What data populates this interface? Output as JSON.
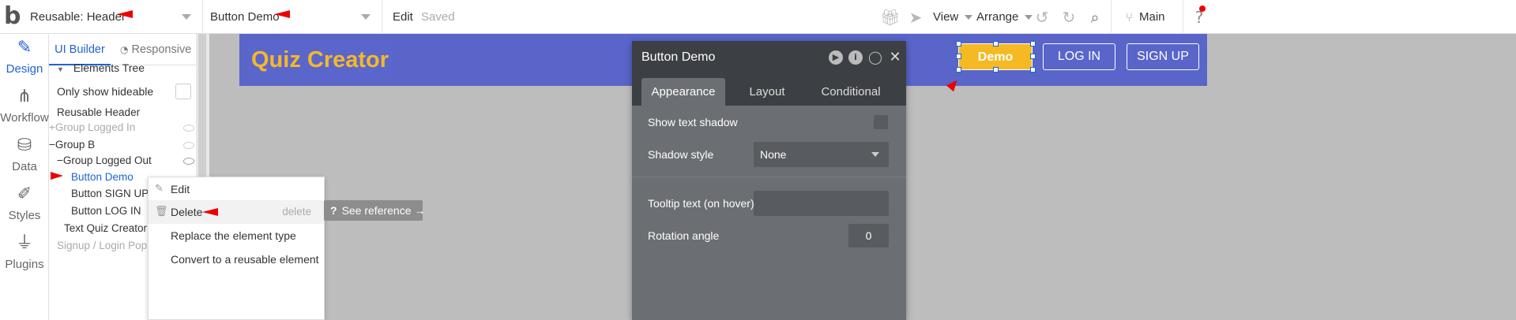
{
  "topbar": {
    "logo_text": "b",
    "page_dropdown": "Reusable: Header",
    "element_dropdown": "Button Demo",
    "edit_label": "Edit",
    "save_status": "Saved",
    "view_label": "View",
    "arrange_label": "Arrange",
    "branch_label": "Main"
  },
  "rail": [
    {
      "label": "Design",
      "icon": "pencil-ruler-icon",
      "glyph": "✎"
    },
    {
      "label": "Workflow",
      "icon": "workflow-icon",
      "glyph": "⋔"
    },
    {
      "label": "Data",
      "icon": "database-icon",
      "glyph": "⛁"
    },
    {
      "label": "Styles",
      "icon": "brush-icon",
      "glyph": "✐"
    },
    {
      "label": "Plugins",
      "icon": "plug-icon",
      "glyph": "⏚"
    }
  ],
  "panel": {
    "tab_ui_builder": "UI Builder",
    "tab_responsive": "Responsive",
    "elements_tree_label": "Elements Tree",
    "only_show_hideable": "Only show hideable",
    "tree": [
      {
        "label": "Reusable Header",
        "prefix": ""
      },
      {
        "label": "Group Logged In",
        "prefix": "+"
      },
      {
        "label": "Group B",
        "prefix": "−"
      },
      {
        "label": "Group Logged Out",
        "prefix": "−"
      },
      {
        "label": "Button Demo",
        "prefix": ""
      },
      {
        "label": "Button SIGN UP",
        "prefix": ""
      },
      {
        "label": "Button LOG IN",
        "prefix": ""
      },
      {
        "label": "Text Quiz Creator",
        "prefix": ""
      },
      {
        "label": "Signup / Login Popup",
        "prefix": ""
      }
    ]
  },
  "context_menu": {
    "edit": "Edit",
    "delete": "Delete",
    "delete_shortcut": "delete",
    "replace": "Replace the element type",
    "convert": "Convert to a reusable element",
    "see_reference": "See reference →"
  },
  "canvas": {
    "title": "Quiz Creator",
    "btn_demo": "Demo",
    "btn_login": "LOG IN",
    "btn_signup": "SIGN UP",
    "colors": {
      "header_bg": "#5965c9",
      "title": "#f5b82a",
      "demo_bg": "#f5b923"
    }
  },
  "property_editor": {
    "title": "Button Demo",
    "tabs": [
      "Appearance",
      "Layout",
      "Conditional"
    ],
    "show_text_shadow_label": "Show text shadow",
    "shadow_style_label": "Shadow style",
    "shadow_style_value": "None",
    "tooltip_label": "Tooltip text (on hover)",
    "tooltip_value": "",
    "rotation_label": "Rotation angle",
    "rotation_value": "0"
  }
}
